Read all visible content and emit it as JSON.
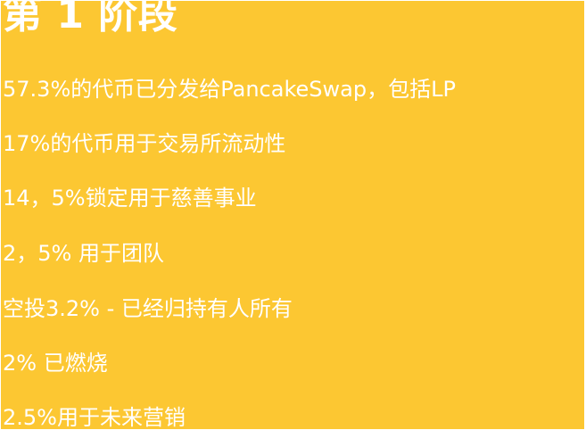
{
  "colors": {
    "background": "#fcc732",
    "text": "#ffffff"
  },
  "phase": {
    "title": "第 1 阶段",
    "items": [
      "57.3%的代币已分发给PancakeSwap，包括LP",
      "17%的代币用于交易所流动性",
      "14，5%锁定用于慈善事业",
      "2，5% 用于团队",
      "空投3.2% - 已经归持有人所有",
      "2% 已燃烧",
      "2.5%用于未来营销"
    ]
  }
}
